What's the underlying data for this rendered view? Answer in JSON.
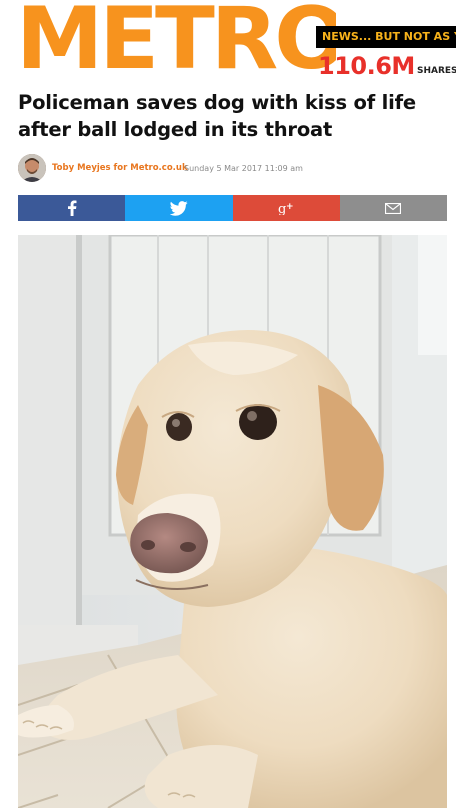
{
  "site": {
    "logo": "METRO",
    "tagline": "NEWS... BUT NOT AS Y",
    "share_count": "110.6M",
    "share_label": "SHARES"
  },
  "article": {
    "headline": "Policeman saves dog with kiss of life after ball lodged in its throat",
    "author": "Toby Meyjes for Metro.co.uk",
    "date": "Sunday 5 Mar 2017 11:09 am"
  },
  "share_buttons": [
    {
      "name": "facebook",
      "icon": "facebook-icon",
      "color": "#3b5998"
    },
    {
      "name": "twitter",
      "icon": "twitter-icon",
      "color": "#1da1f2"
    },
    {
      "name": "google-plus",
      "icon": "google-plus-icon",
      "color": "#dd4b39"
    },
    {
      "name": "email",
      "icon": "email-icon",
      "color": "#8e8e8e"
    }
  ],
  "colors": {
    "brand": "#f7931e",
    "share_count": "#e8302a",
    "author": "#e8761f"
  }
}
